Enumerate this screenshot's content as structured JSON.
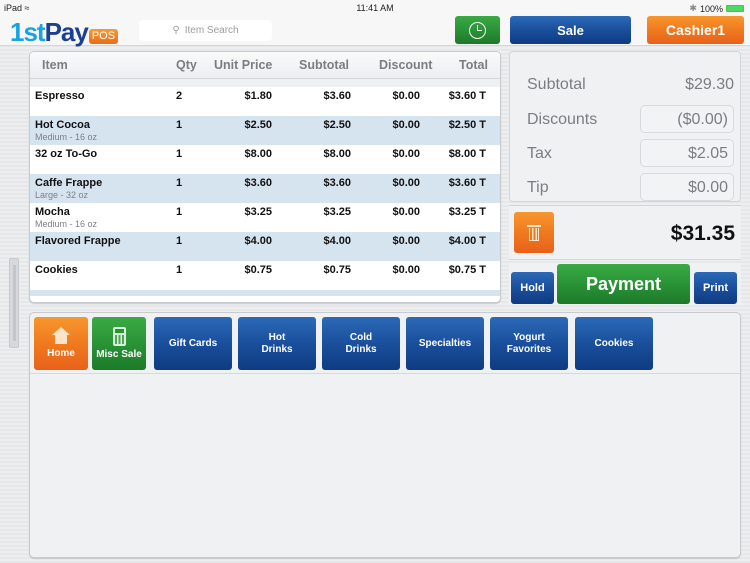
{
  "status_bar": {
    "device": "iPad",
    "time": "11:41 AM",
    "battery": "100%"
  },
  "header": {
    "logo_main_a": "1st",
    "logo_main_b": "Pay",
    "logo_badge": "POS",
    "search_placeholder": "Item Search",
    "clock_icon": "clock-icon",
    "sale_label": "Sale",
    "cashier_label": "Cashier1"
  },
  "colors": {
    "green": "#2a9336",
    "blue": "#1a4f9c",
    "orange": "#f07a1e",
    "row_alt": "#d6e4f0"
  },
  "order": {
    "columns": [
      "Item",
      "Qty",
      "Unit Price",
      "Subtotal",
      "Discount",
      "Total"
    ],
    "rows": [
      {
        "item": "Espresso",
        "modifier": "",
        "qty": "2",
        "unit_price": "$1.80",
        "subtotal": "$3.60",
        "discount": "$0.00",
        "total": "$3.60 T"
      },
      {
        "item": "Hot Cocoa",
        "modifier": "Medium - 16 oz",
        "qty": "1",
        "unit_price": "$2.50",
        "subtotal": "$2.50",
        "discount": "$0.00",
        "total": "$2.50 T"
      },
      {
        "item": "32 oz To-Go",
        "modifier": "",
        "qty": "1",
        "unit_price": "$8.00",
        "subtotal": "$8.00",
        "discount": "$0.00",
        "total": "$8.00 T"
      },
      {
        "item": "Caffe Frappe",
        "modifier": "Large - 32 oz",
        "qty": "1",
        "unit_price": "$3.60",
        "subtotal": "$3.60",
        "discount": "$0.00",
        "total": "$3.60 T"
      },
      {
        "item": "Mocha",
        "modifier": "Medium - 16 oz",
        "qty": "1",
        "unit_price": "$3.25",
        "subtotal": "$3.25",
        "discount": "$0.00",
        "total": "$3.25 T"
      },
      {
        "item": "Flavored Frappe",
        "modifier": "",
        "qty": "1",
        "unit_price": "$4.00",
        "subtotal": "$4.00",
        "discount": "$0.00",
        "total": "$4.00 T"
      },
      {
        "item": "Cookies",
        "modifier": "",
        "qty": "1",
        "unit_price": "$0.75",
        "subtotal": "$0.75",
        "discount": "$0.00",
        "total": "$0.75 T"
      }
    ]
  },
  "totals": {
    "subtotal_label": "Subtotal",
    "subtotal_value": "$29.30",
    "discounts_label": "Discounts",
    "discounts_value": "($0.00)",
    "tax_label": "Tax",
    "tax_value": "$2.05",
    "tip_label": "Tip",
    "tip_value": "$0.00",
    "grand_total": "$31.35"
  },
  "actions": {
    "hold": "Hold",
    "payment": "Payment",
    "print": "Print"
  },
  "categories": {
    "home": "Home",
    "misc_sale": "Misc Sale",
    "items": [
      "Gift Cards",
      "Hot Drinks",
      "Cold Drinks",
      "Specialties",
      "Yogurt Favorites",
      "Cookies"
    ]
  }
}
